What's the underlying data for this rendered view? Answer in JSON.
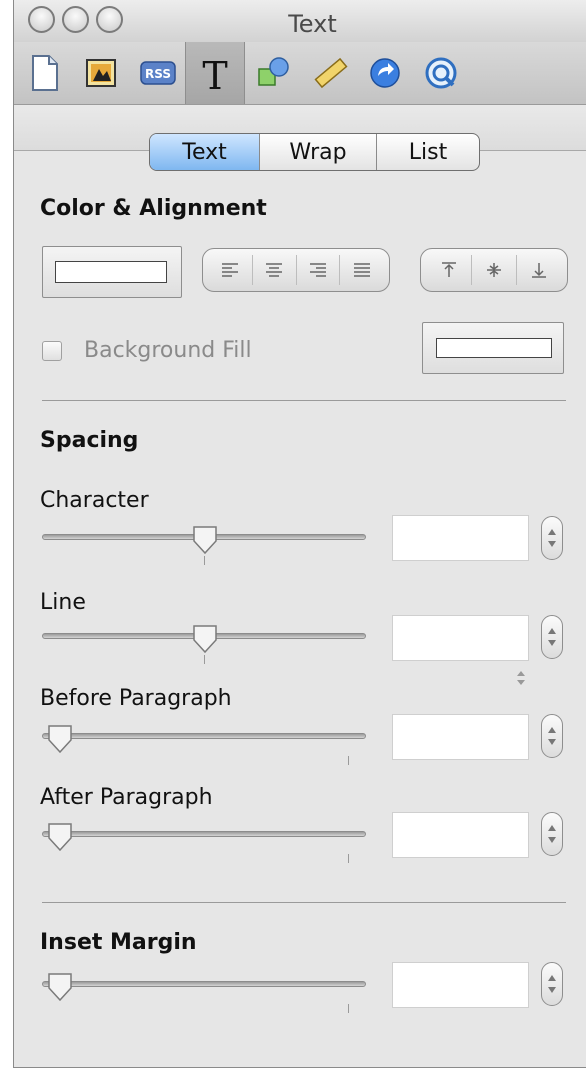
{
  "window": {
    "title": "Text"
  },
  "toolbar": {
    "items": [
      {
        "name": "document-icon",
        "active": false
      },
      {
        "name": "image-icon",
        "active": false
      },
      {
        "name": "rss-icon",
        "label": "RSS",
        "active": false
      },
      {
        "name": "text-icon",
        "label": "T",
        "active": true
      },
      {
        "name": "shapes-icon",
        "active": false
      },
      {
        "name": "ruler-icon",
        "active": false
      },
      {
        "name": "link-icon",
        "active": false
      },
      {
        "name": "quicktime-icon",
        "active": false
      }
    ]
  },
  "tabs": [
    {
      "label": "Text",
      "selected": true
    },
    {
      "label": "Wrap",
      "selected": false
    },
    {
      "label": "List",
      "selected": false
    }
  ],
  "color_alignment": {
    "heading": "Color & Alignment",
    "background_fill_label": "Background Fill",
    "background_fill_checked": false
  },
  "spacing": {
    "heading": "Spacing",
    "character": {
      "label": "Character",
      "value": "",
      "level": 0.5
    },
    "line": {
      "label": "Line",
      "value": "",
      "level": 0.5
    },
    "before_paragraph": {
      "label": "Before Paragraph",
      "value": "",
      "level": 0.0
    },
    "after_paragraph": {
      "label": "After Paragraph",
      "value": "",
      "level": 0.0
    }
  },
  "inset": {
    "heading": "Inset Margin",
    "value": "",
    "level": 0.0
  },
  "colors": {
    "accent": "#7fb7f0",
    "panel": "#e6e6e6"
  }
}
